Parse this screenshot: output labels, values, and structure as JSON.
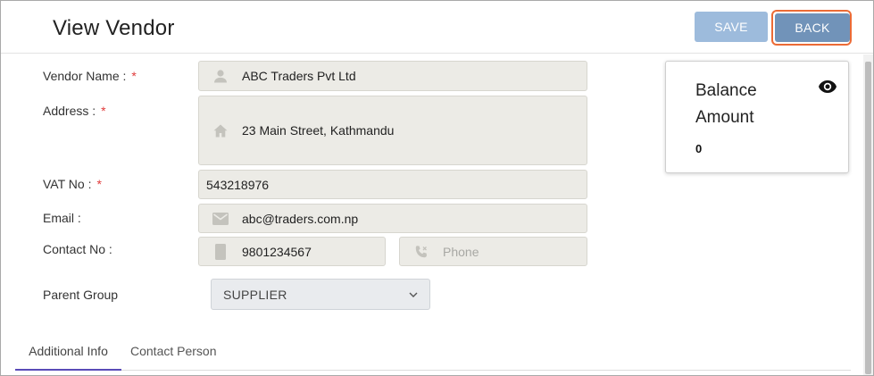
{
  "header": {
    "title": "View Vendor",
    "save_label": "SAVE",
    "back_label": "BACK"
  },
  "form": {
    "vendor_name": {
      "label": "Vendor Name :",
      "required": "*",
      "value": "ABC Traders Pvt Ltd",
      "icon": "person-icon"
    },
    "address": {
      "label": "Address :",
      "required": "*",
      "value": "23 Main Street, Kathmandu",
      "icon": "home-icon"
    },
    "vat_no": {
      "label": "VAT No :",
      "required": "*",
      "value": "543218976"
    },
    "email": {
      "label": "Email :",
      "value": "abc@traders.com.np",
      "icon": "mail-icon"
    },
    "contact_no": {
      "label": "Contact No :",
      "mobile_value": "9801234567",
      "mobile_icon": "mobile-icon",
      "phone_placeholder": "Phone",
      "phone_icon": "phone-icon"
    },
    "parent_group": {
      "label": "Parent Group",
      "value": "SUPPLIER"
    }
  },
  "balance": {
    "title": "Balance Amount",
    "value": "0",
    "icon": "eye-icon"
  },
  "tabs": [
    {
      "label": "Additional Info",
      "active": true
    },
    {
      "label": "Contact Person",
      "active": false
    }
  ],
  "colors": {
    "save_button": "#9dbbdc",
    "back_button": "#7193b9",
    "back_focus_ring": "#ec6b36",
    "field_bg": "#ecebe6",
    "required": "#e03b3b",
    "active_tab_underline": "#5a4bb8"
  }
}
